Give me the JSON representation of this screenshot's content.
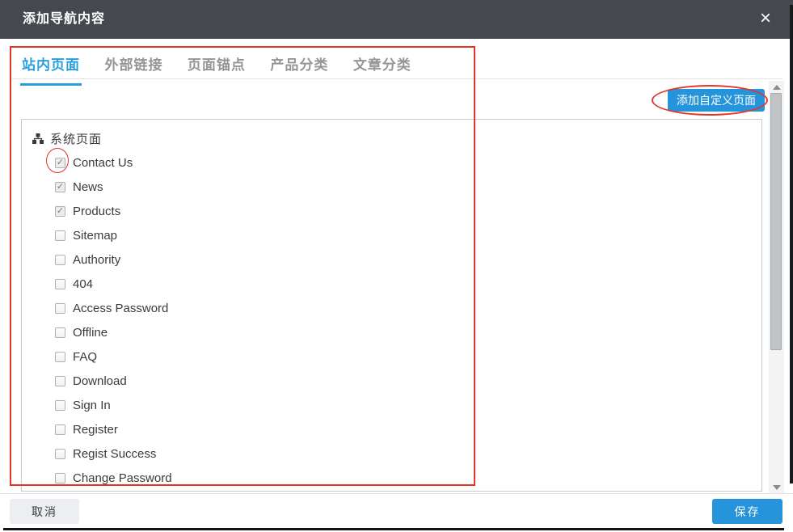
{
  "modal": {
    "title": "添加导航内容",
    "close_icon": "×"
  },
  "tabs": [
    {
      "label": "站内页面",
      "active": true
    },
    {
      "label": "外部链接",
      "active": false
    },
    {
      "label": "页面锚点",
      "active": false
    },
    {
      "label": "产品分类",
      "active": false
    },
    {
      "label": "文章分类",
      "active": false
    }
  ],
  "toolbar": {
    "add_custom_page_label": "添加自定义页面"
  },
  "tree": {
    "root_label": "系统页面",
    "root_icon": "sitemap-icon",
    "check_glyph": "✓",
    "items": [
      {
        "label": "Contact Us",
        "checked": true,
        "annotated": true
      },
      {
        "label": "News",
        "checked": true
      },
      {
        "label": "Products",
        "checked": true
      },
      {
        "label": "Sitemap",
        "checked": false
      },
      {
        "label": "Authority",
        "checked": false
      },
      {
        "label": "404",
        "checked": false
      },
      {
        "label": "Access Password",
        "checked": false
      },
      {
        "label": "Offline",
        "checked": false
      },
      {
        "label": "FAQ",
        "checked": false
      },
      {
        "label": "Download",
        "checked": false
      },
      {
        "label": "Sign In",
        "checked": false
      },
      {
        "label": "Register",
        "checked": false
      },
      {
        "label": "Regist Success",
        "checked": false
      },
      {
        "label": "Change Password",
        "checked": false
      }
    ]
  },
  "footer": {
    "cancel_label": "取消",
    "save_label": "保存"
  },
  "annotations": {
    "color": "#e5332a",
    "marks": [
      "content-rectangle",
      "add-custom-page-ellipse",
      "contact-us-checkbox-ellipse"
    ]
  },
  "colors": {
    "header_bg": "#45484e",
    "accent_blue": "#2594db",
    "tab_active_blue": "#29a0dd"
  }
}
